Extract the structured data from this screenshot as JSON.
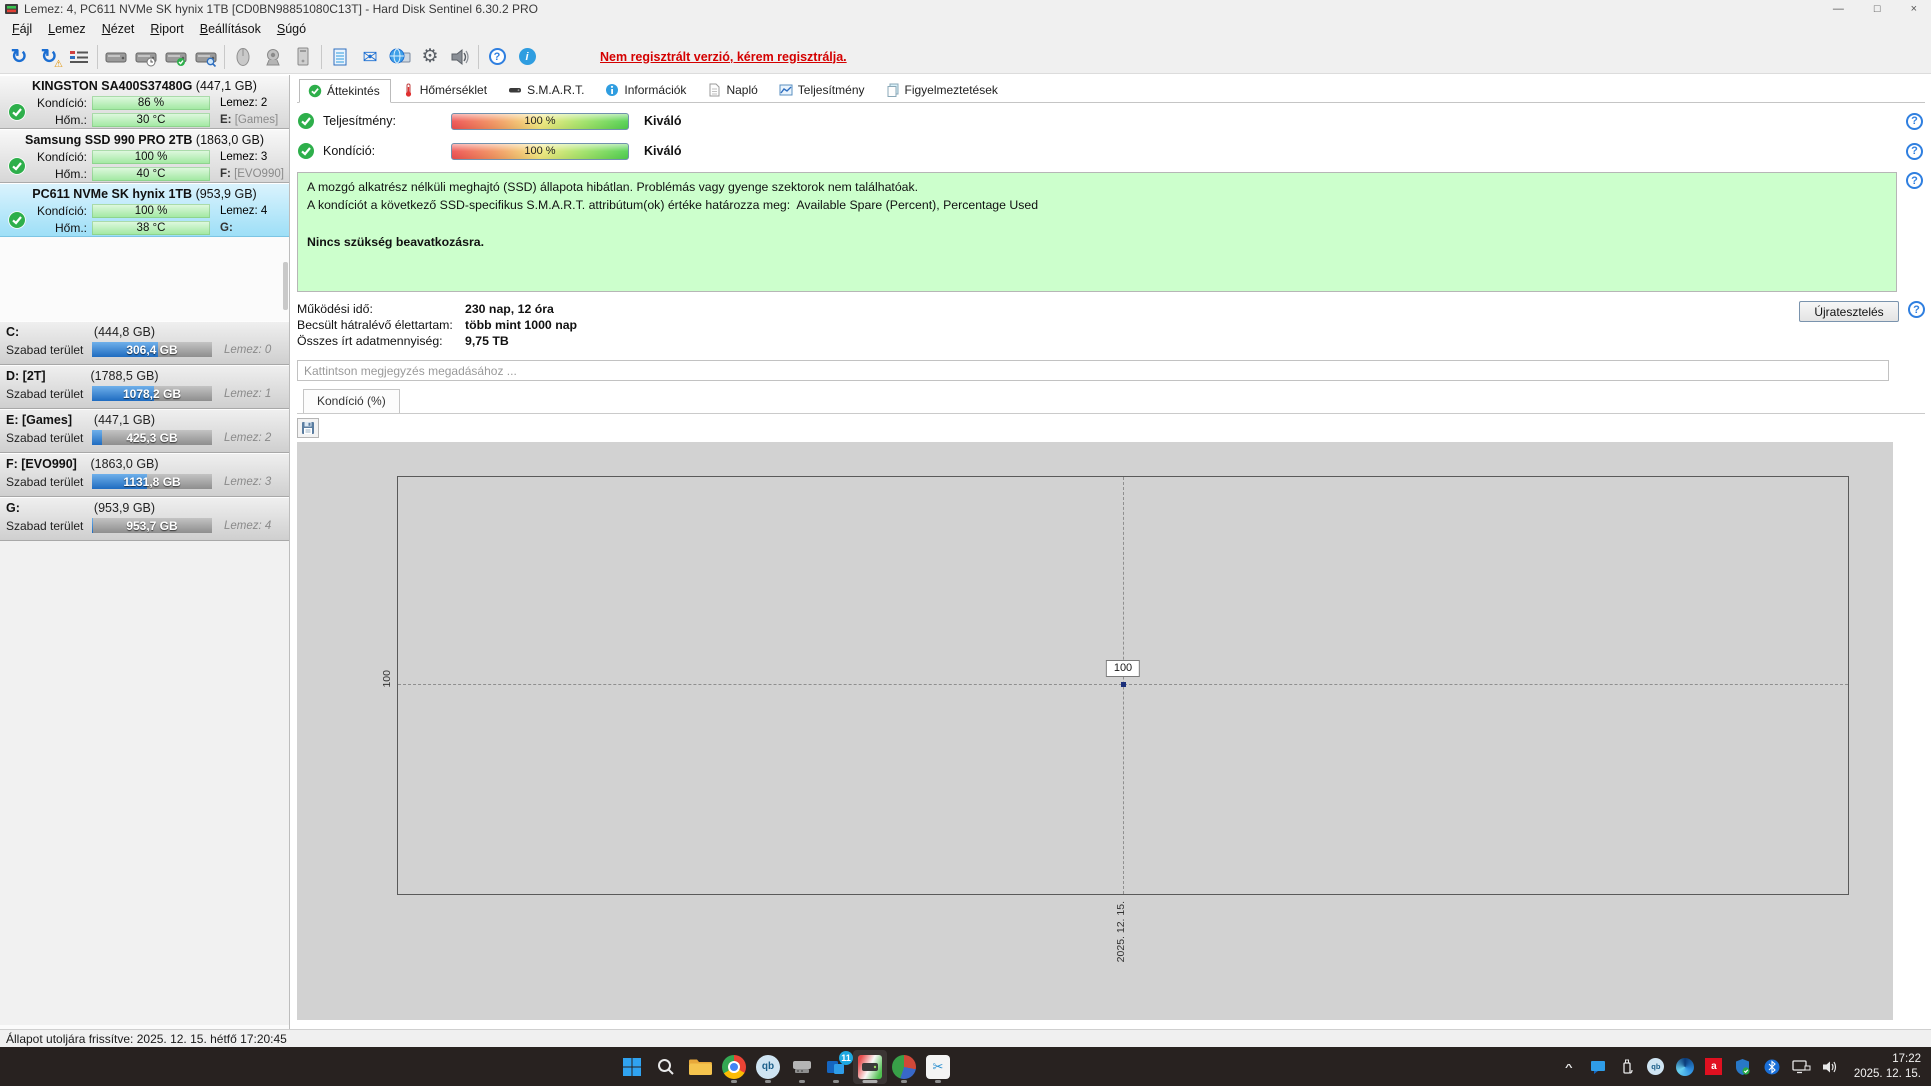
{
  "window": {
    "title": "Lemez: 4, PC611 NVMe SK hynix 1TB [CD0BN98851080C13T]  -  Hard Disk Sentinel 6.30.2 PRO",
    "controls": {
      "minimize": "—",
      "maximize": "□",
      "close": "×"
    }
  },
  "menu": [
    "Fájl",
    "Lemez",
    "Nézet",
    "Riport",
    "Beállítások",
    "Súgó"
  ],
  "icons": {
    "refresh": "↻",
    "warning": "⚠",
    "gear": "⚙",
    "envelope": "✉",
    "help": "?",
    "info": "i",
    "scissors": "✂",
    "chevron_up": "^",
    "amd": "a",
    "qb": "qb"
  },
  "toolbar": {
    "warning_text": "Nem regisztrált verzió, kérem regisztrálja."
  },
  "sidebar": {
    "disks": [
      {
        "name": "KINGSTON SA400S37480G",
        "size": "(447,1 GB)",
        "cond_label": "Kondíció:",
        "cond_value": "86 %",
        "temp_label": "Hőm.:",
        "temp_value": "30 °C",
        "disk_no": "Lemez: 2",
        "drive": "E:",
        "drive_label": "[Games]"
      },
      {
        "name": "Samsung SSD 990 PRO 2TB",
        "size": "(1863,0 GB)",
        "cond_label": "Kondíció:",
        "cond_value": "100 %",
        "temp_label": "Hőm.:",
        "temp_value": "40 °C",
        "disk_no": "Lemez: 3",
        "drive": "F:",
        "drive_label": "[EVO990]"
      },
      {
        "name": "PC611 NVMe SK hynix 1TB",
        "size": "(953,9 GB)",
        "cond_label": "Kondíció:",
        "cond_value": "100 %",
        "temp_label": "Hőm.:",
        "temp_value": "38 °C",
        "disk_no": "Lemez: 4",
        "drive": "G:",
        "drive_label": ""
      }
    ],
    "partitions": [
      {
        "name": "C:",
        "size": "(444,8 GB)",
        "free_label": "Szabad terület",
        "free_value": "306,4 GB",
        "used_pct": 55,
        "disk_no": "Lemez: 0"
      },
      {
        "name": "D: [2T]",
        "size": "(1788,5 GB)",
        "free_label": "Szabad terület",
        "free_value": "1078,2 GB",
        "used_pct": 52,
        "disk_no": "Lemez: 1"
      },
      {
        "name": "E: [Games]",
        "size": "(447,1 GB)",
        "free_label": "Szabad terület",
        "free_value": "425,3 GB",
        "used_pct": 8,
        "disk_no": "Lemez: 2"
      },
      {
        "name": "F: [EVO990]",
        "size": "(1863,0 GB)",
        "free_label": "Szabad terület",
        "free_value": "1131,8 GB",
        "used_pct": 46,
        "disk_no": "Lemez: 3"
      },
      {
        "name": "G:",
        "size": "(953,9 GB)",
        "free_label": "Szabad terület",
        "free_value": "953,7 GB",
        "used_pct": 1,
        "disk_no": "Lemez: 4"
      }
    ]
  },
  "main": {
    "tabs": [
      "Áttekintés",
      "Hőmérséklet",
      "S.M.A.R.T.",
      "Információk",
      "Napló",
      "Teljesítmény",
      "Figyelmeztetések"
    ],
    "perf_label": "Teljesítmény:",
    "perf_value": "100 %",
    "perf_rating": "Kiváló",
    "cond_label": "Kondíció:",
    "cond_value": "100 %",
    "cond_rating": "Kiváló",
    "info_line1": "A mozgó alkatrész nélküli meghajtó (SSD) állapota hibátlan. Problémás vagy gyenge szektorok nem találhatóak.",
    "info_line2": "A kondíciót a következő SSD-specifikus S.M.A.R.T. attribútum(ok) értéke határozza meg:  Available Spare (Percent), Percentage Used",
    "info_line3": "Nincs szükség beavatkozásra.",
    "stats": [
      {
        "label": "Működési idő:",
        "value": "230 nap, 12 óra"
      },
      {
        "label": "Becsült hátralévő élettartam:",
        "value": "több mint 1000 nap"
      },
      {
        "label": "Összes írt adatmennyiség:",
        "value": "9,75 TB"
      }
    ],
    "retest_button": "Újratesztelés",
    "comment_placeholder": "Kattintson megjegyzés megadásához ..."
  },
  "chart_data": {
    "type": "line",
    "title": "Kondíció  (%)",
    "x": [
      "2025. 12. 15."
    ],
    "values": [
      100
    ],
    "series": [
      {
        "name": "Kondíció",
        "values": [
          100
        ]
      }
    ],
    "point_label": "100",
    "ytick_label": "100",
    "xlabel": "",
    "ylabel": "",
    "grid": "dashed-crosshair-at-point",
    "legend": "none",
    "plot_bg": "#d2d2d2"
  },
  "statusbar": {
    "text": "Állapot utoljára frissítve: 2025. 12. 15. hétfő 17:20:45"
  },
  "taskbar": {
    "mail_badge": "11",
    "clock_time": "17:22",
    "clock_date": "2025. 12. 15."
  },
  "colors": {
    "accent_blue": "#1b6ed2",
    "health_green": "#2eaf4b",
    "warning_red": "#d40000",
    "selected_panel_blue": "#9edff7",
    "info_box_green": "#ccffcc",
    "free_fill_blue": "#1f6cc0",
    "meter_red": "#ee4f4f",
    "meter_green": "#4fd04f",
    "taskbar_bg": "#282220"
  }
}
